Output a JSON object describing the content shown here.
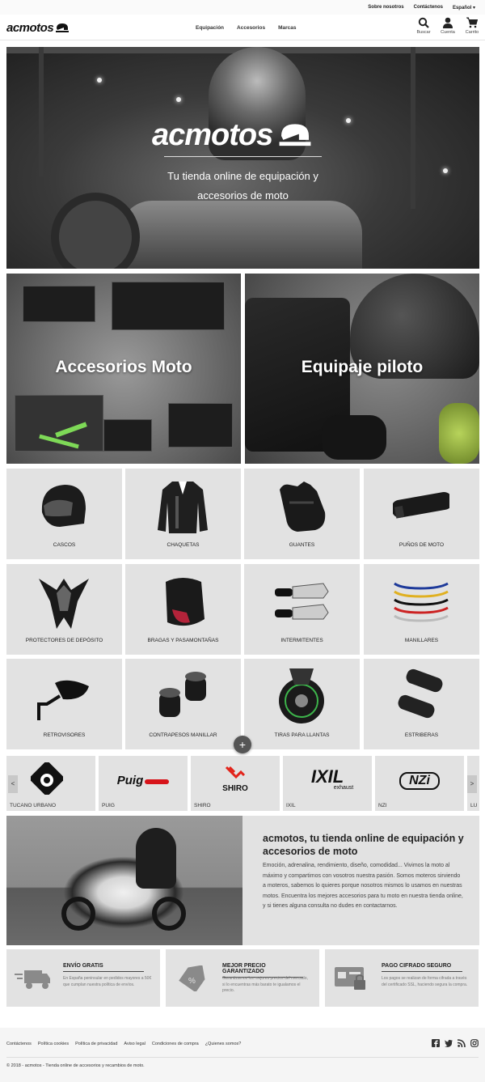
{
  "topbar": {
    "about": "Sobre nosotros",
    "contact": "Contáctenos",
    "language": "Español"
  },
  "header": {
    "logo_text": "acmotos",
    "nav": [
      "Equipación",
      "Accesorios",
      "Marcas"
    ],
    "icons": [
      {
        "icon": "search-icon",
        "label": "Buscar"
      },
      {
        "icon": "user-icon",
        "label": "Cuenta"
      },
      {
        "icon": "cart-icon",
        "label": "Carrito"
      }
    ]
  },
  "hero": {
    "logo_text": "acmotos",
    "tagline_1": "Tu tienda online de equipación y",
    "tagline_2": "accesorios de moto"
  },
  "promos": {
    "accessories": "Accesorios Moto",
    "equipment": "Equipaje piloto"
  },
  "categories": [
    "CASCOS",
    "CHAQUETAS",
    "GUANTES",
    "PUÑOS DE MOTO",
    "PROTECTORES DE DEPÓSITO",
    "BRAGAS Y PASAMONTAÑAS",
    "INTERMITENTES",
    "MANILLARES",
    "RETROVISORES",
    "CONTRAPESOS MANILLAR",
    "TIRAS PARA LLANTAS",
    "ESTRIBERAS"
  ],
  "brands": {
    "names": [
      "TUCANO URBANO",
      "PUIG",
      "SHIRO",
      "IXIL",
      "NZI",
      "LU"
    ],
    "logos": {
      "puig": "Puig",
      "shiro": "SHIRO",
      "ixil": "IXIL",
      "ixil_sub": "exhaust",
      "nzi": "NZi"
    },
    "prev": "<",
    "next": ">"
  },
  "more_button": "+",
  "about": {
    "title": "acmotos, tu tienda online de equipación y accesorios de moto",
    "body": "Emoción, adrenalina, rendimiento, diseño, comodidad... Vivimos la moto al máximo y compartimos con vosotros nuestra pasión. Somos moteros sirviendo a moteros, sabemos lo quieres porque nosotros mismos lo usamos en nuestras motos. Encuentra los mejores accesorios para tu moto en nuestra tienda online, y si tienes alguna consulta no dudes en contactarnos."
  },
  "features": [
    {
      "title": "ENVÍO GRATIS",
      "desc": "En España peninsular en pedidos mayores a 50€ que cumplan nuestra política de envíos."
    },
    {
      "title": "MEJOR PRECIO GARANTIZADO",
      "desc": "Garantizamos los mejores precios del mercado, si lo encuentras más barato te igualamos el precio."
    },
    {
      "title": "PAGO CIFRADO SEGURO",
      "desc": "Los pagos se realizan de forma cifrada a través del certificado SSL, haciendo segura la compra."
    }
  ],
  "footer": {
    "links": [
      "Contáctenos",
      "Política cookies",
      "Política de privacidad",
      "Aviso legal",
      "Condiciones de compra",
      "¿Quienes somos?"
    ],
    "social": [
      "facebook-icon",
      "twitter-icon",
      "rss-icon",
      "instagram-icon"
    ],
    "copyright": "© 2018 - acmotos - Tienda online de accesorios y recambios de moto."
  },
  "colors": {
    "shiro_red": "#e2231a",
    "puig_red": "#d7141a",
    "tile_bg": "#e2e2e2"
  }
}
